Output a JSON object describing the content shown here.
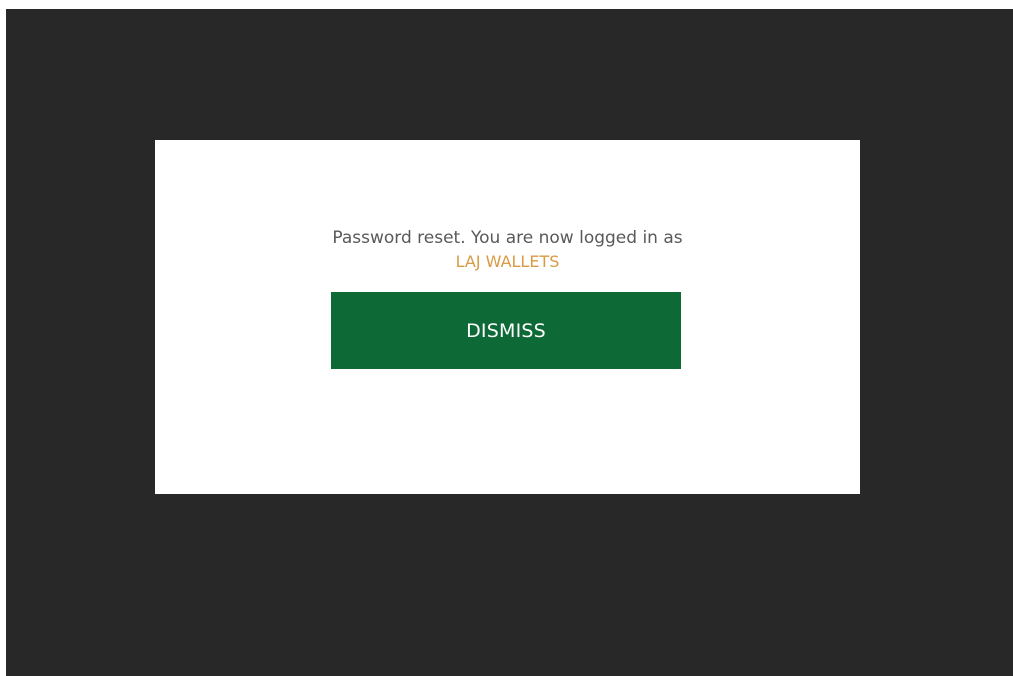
{
  "dialog": {
    "message": "Password reset. You are now logged in as",
    "username": "LAJ WALLETS",
    "dismiss_label": "DISMISS"
  },
  "colors": {
    "overlay": "#282828",
    "username": "#d89b45",
    "dismiss_button": "#0d6a36"
  }
}
